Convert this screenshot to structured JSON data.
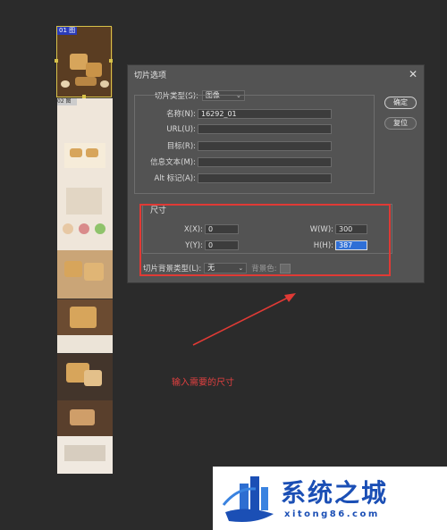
{
  "dialog": {
    "title": "切片选项",
    "close_icon": "close-icon",
    "slice_type_label": "切片类型(S):",
    "slice_type_value": "图像",
    "name_label": "名称(N):",
    "name_value": "16292_01",
    "url_label": "URL(U):",
    "url_value": "",
    "target_label": "目标(R):",
    "target_value": "",
    "message_label": "信息文本(M):",
    "message_value": "",
    "alt_label": "Alt 标记(A):",
    "alt_value": "",
    "dimensions_title": "尺寸",
    "x_label": "X(X):",
    "x_value": "0",
    "y_label": "Y(Y):",
    "y_value": "0",
    "w_label": "W(W):",
    "w_value": "300",
    "h_label": "H(H):",
    "h_value": "387",
    "bg_type_label": "切片背景类型(L):",
    "bg_type_value": "无",
    "bg_color_label": "背景色:",
    "ok_label": "确定",
    "reset_label": "复位"
  },
  "canvas": {
    "slice_tag_1": "01 图",
    "slice_tag_2": "02 图"
  },
  "annotation": {
    "text": "输入需要的尺寸",
    "color": "#e03a35"
  },
  "watermark": {
    "title": "系统之城",
    "url": "xitong86.com",
    "color": "#1b4fb5"
  }
}
